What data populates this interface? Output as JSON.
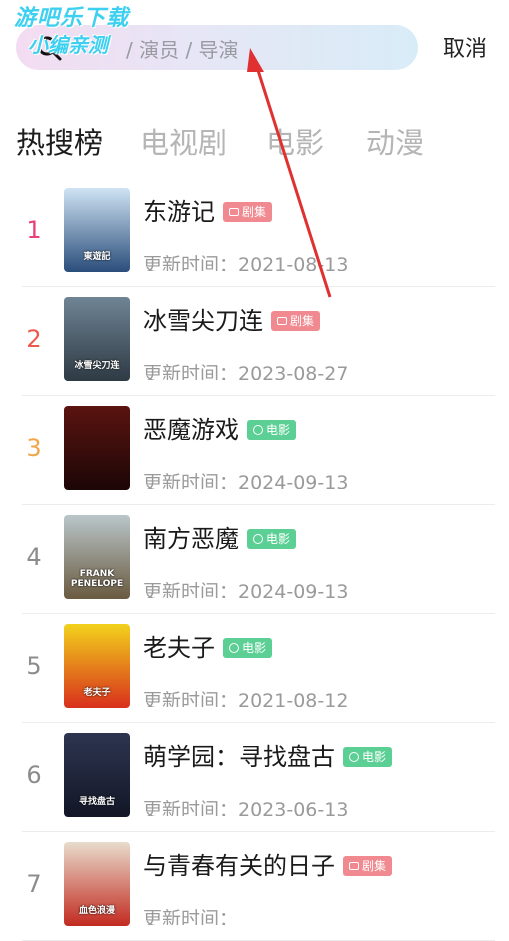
{
  "watermark": {
    "line1": "游吧乐下载",
    "line2": "小编亲测"
  },
  "search": {
    "placeholder": "/ 演员 / 导演",
    "cancel_label": "取消"
  },
  "tabs": [
    {
      "label": "热搜榜",
      "active": true
    },
    {
      "label": "电视剧",
      "active": false
    },
    {
      "label": "电影",
      "active": false
    },
    {
      "label": "动漫",
      "active": false
    }
  ],
  "updated_prefix": "更新时间：",
  "colors": {
    "rank_1": "#e8407a",
    "rank_2": "#ec5a4e",
    "rank_3": "#f0a64a",
    "rank_other": "#8c8c8c",
    "badge_series": "#f08a90",
    "badge_movie": "#5ccf95",
    "annotation_arrow": "#e03030"
  },
  "items": [
    {
      "rank": "1",
      "title": "东游记",
      "badge": "剧集",
      "badge_type": "series",
      "updated": "更新时间：2021-08-13",
      "poster_text": "東遊記",
      "poster_colors": [
        "#cfe3f4",
        "#2a4d7a"
      ]
    },
    {
      "rank": "2",
      "title": "冰雪尖刀连",
      "badge": "剧集",
      "badge_type": "series",
      "updated": "更新时间：2023-08-27",
      "poster_text": "冰雪尖刀连",
      "poster_colors": [
        "#6f8494",
        "#2e3a44"
      ]
    },
    {
      "rank": "3",
      "title": "恶魔游戏",
      "badge": "电影",
      "badge_type": "movie",
      "updated": "更新时间：2024-09-13",
      "poster_text": "",
      "poster_colors": [
        "#5a1410",
        "#1c0606"
      ]
    },
    {
      "rank": "4",
      "title": "南方恶魔",
      "badge": "电影",
      "badge_type": "movie",
      "updated": "更新时间：2024-09-13",
      "poster_text": "FRANK PENELOPE",
      "poster_colors": [
        "#b9c6c9",
        "#6a5a40"
      ]
    },
    {
      "rank": "5",
      "title": "老夫子",
      "badge": "电影",
      "badge_type": "movie",
      "updated": "更新时间：2021-08-12",
      "poster_text": "老夫子",
      "poster_colors": [
        "#f2d21c",
        "#d8301c"
      ]
    },
    {
      "rank": "6",
      "title": "萌学园：寻找盘古",
      "badge": "电影",
      "badge_type": "movie",
      "updated": "更新时间：2023-06-13",
      "poster_text": "寻找盘古",
      "poster_colors": [
        "#2d3550",
        "#121626"
      ]
    },
    {
      "rank": "7",
      "title": "与青春有关的日子",
      "badge": "剧集",
      "badge_type": "series",
      "updated": "更新时间：",
      "poster_text": "血色浪漫",
      "poster_colors": [
        "#e8dccc",
        "#c22a20"
      ]
    }
  ]
}
